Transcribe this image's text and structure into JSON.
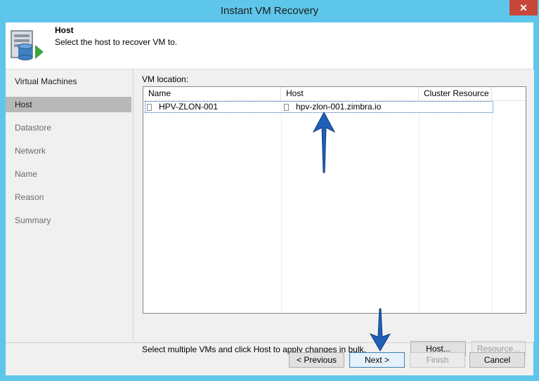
{
  "window": {
    "title": "Instant VM Recovery",
    "close_label": "✕"
  },
  "header": {
    "title": "Host",
    "subtitle": "Select the host to recover VM to.",
    "icon": "server-database-icon"
  },
  "nav": {
    "items": [
      {
        "label": "Virtual Machines"
      },
      {
        "label": "Host"
      },
      {
        "label": "Datastore"
      },
      {
        "label": "Network"
      },
      {
        "label": "Name"
      },
      {
        "label": "Reason"
      },
      {
        "label": "Summary"
      }
    ],
    "active": "Host"
  },
  "main": {
    "vm_location_label": "VM location:",
    "columns": [
      "Name",
      "Host",
      "Cluster Resource"
    ],
    "rows": [
      {
        "name": "HPV-ZLON-001",
        "host": "hpv-zlon-001.zimbra.io",
        "cluster": ""
      }
    ],
    "bulk_text": "Select multiple VMs and click Host to apply changes in bulk.",
    "host_button": "Host...",
    "resource_button": "Resource..."
  },
  "footer": {
    "previous": "< Previous",
    "next": "Next >",
    "finish": "Finish",
    "cancel": "Cancel"
  },
  "colors": {
    "window_frame": "#5ec6ea",
    "close_button": "#c7463a",
    "annotation_arrow": "#1f5fb8",
    "nav_selected": "#b8b8b8"
  }
}
